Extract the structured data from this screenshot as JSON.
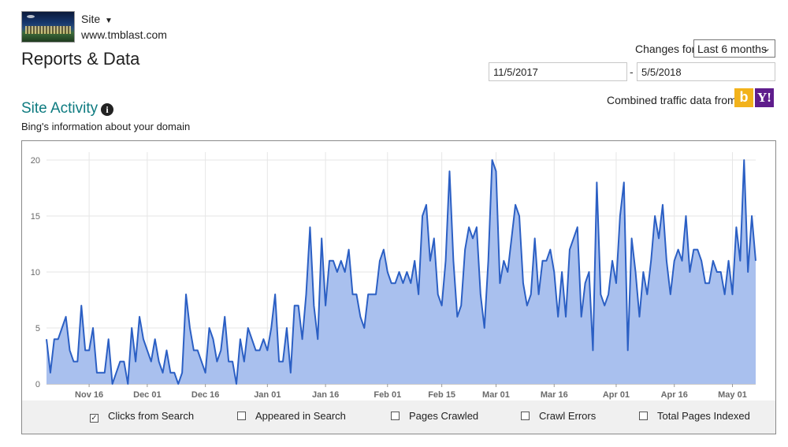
{
  "header": {
    "site_label": "Site",
    "site_url": "www.tmblast.com",
    "page_title": "Reports & Data"
  },
  "range": {
    "changes_label": "Changes for",
    "period": "Last 6 months",
    "start_date": "11/5/2017",
    "end_date": "5/5/2018",
    "dash": "-"
  },
  "traffic": {
    "combined_label": "Combined traffic data from",
    "bing_icon": "bing-logo",
    "yahoo_icon": "yahoo-logo",
    "bing_glyph": "b",
    "yahoo_glyph": "Y!"
  },
  "section": {
    "title": "Site Activity",
    "info_glyph": "i",
    "subtitle": "Bing's information about your domain"
  },
  "legend": [
    {
      "label": "Clicks from Search",
      "checked": true
    },
    {
      "label": "Appeared in Search",
      "checked": false
    },
    {
      "label": "Pages Crawled",
      "checked": false
    },
    {
      "label": "Crawl Errors",
      "checked": false
    },
    {
      "label": "Total Pages Indexed",
      "checked": false
    }
  ],
  "colors": {
    "accent": "#0e7b80",
    "line": "#2b5fc4",
    "fill": "#a9c0ee",
    "grid": "#e6e6e6"
  },
  "chart_data": {
    "type": "area",
    "title": "",
    "xlabel": "",
    "ylabel": "",
    "ylim": [
      0,
      20
    ],
    "y_ticks": [
      0,
      5,
      10,
      15,
      20
    ],
    "x_tick_labels": [
      "Nov 16",
      "Dec 01",
      "Dec 16",
      "Jan 01",
      "Jan 16",
      "Feb 01",
      "Feb 15",
      "Mar 01",
      "Mar 16",
      "Apr 01",
      "Apr 16",
      "May 01"
    ],
    "x_tick_days": [
      11,
      26,
      41,
      57,
      72,
      88,
      102,
      116,
      131,
      147,
      162,
      177
    ],
    "grid": true,
    "series": [
      {
        "name": "Clicks from Search",
        "x_start": "11/5/2017",
        "values": [
          4,
          1,
          4,
          4,
          5,
          6,
          3,
          2,
          2,
          7,
          3,
          3,
          5,
          1,
          1,
          1,
          4,
          0,
          1,
          2,
          2,
          0,
          5,
          2,
          6,
          4,
          3,
          2,
          4,
          2,
          1,
          3,
          1,
          1,
          0,
          1,
          8,
          5,
          3,
          3,
          2,
          1,
          5,
          4,
          2,
          3,
          6,
          2,
          2,
          0,
          4,
          2,
          5,
          4,
          3,
          3,
          4,
          3,
          5,
          8,
          2,
          2,
          5,
          1,
          7,
          7,
          4,
          8,
          14,
          7,
          4,
          13,
          7,
          11,
          11,
          10,
          11,
          10,
          12,
          8,
          8,
          6,
          5,
          8,
          8,
          8,
          11,
          12,
          10,
          9,
          9,
          10,
          9,
          10,
          9,
          11,
          8,
          15,
          16,
          11,
          13,
          8,
          7,
          11,
          19,
          11,
          6,
          7,
          12,
          14,
          13,
          14,
          8,
          5,
          11,
          20,
          19,
          9,
          11,
          10,
          13,
          16,
          15,
          9,
          7,
          8,
          13,
          8,
          11,
          11,
          12,
          10,
          6,
          10,
          6,
          12,
          13,
          14,
          6,
          9,
          10,
          3,
          18,
          8,
          7,
          8,
          11,
          9,
          15,
          18,
          3,
          13,
          10,
          6,
          10,
          8,
          11,
          15,
          13,
          16,
          11,
          8,
          11,
          12,
          11,
          15,
          10,
          12,
          12,
          11,
          9,
          9,
          11,
          10,
          10,
          8,
          11,
          8,
          14,
          11,
          20,
          10,
          15,
          11
        ]
      }
    ]
  }
}
